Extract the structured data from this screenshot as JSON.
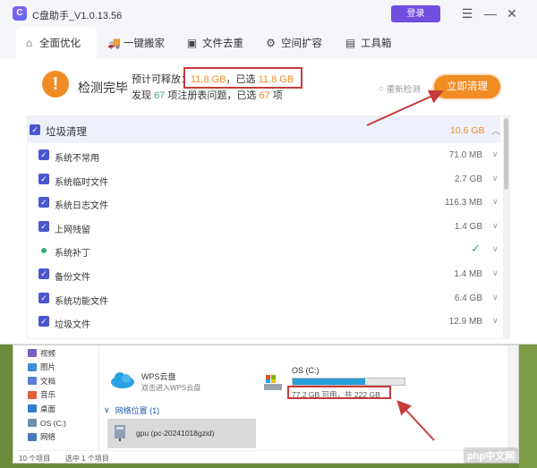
{
  "app": {
    "logo_text": "C",
    "title": "C盘助手_V1.0.13.56",
    "login_label": "登录",
    "controls": {
      "menu_icon": "menu-icon",
      "minimize_icon": "minimize-icon",
      "close_icon": "close-icon"
    }
  },
  "tabs": [
    {
      "label": "全面优化",
      "icon": "home-icon",
      "active": true
    },
    {
      "label": "一键搬家",
      "icon": "truck-icon",
      "active": false
    },
    {
      "label": "文件去重",
      "icon": "files-icon",
      "active": false
    },
    {
      "label": "空间扩容",
      "icon": "expand-icon",
      "active": false
    },
    {
      "label": "工具箱",
      "icon": "toolbox-icon",
      "active": false
    }
  ],
  "status": {
    "title": "检测完毕",
    "line1_prefix": "预计可释放：",
    "line1_value": "11.8 GB",
    "line1_mid": "，已选",
    "line1_selected": "11.8 GB",
    "line2_prefix": "发现",
    "line2_count": "67",
    "line2_mid": "项注册表问题，已选",
    "line2_selected": "67",
    "line2_suffix": "项",
    "recheck_label": "重新检测",
    "clean_label": "立即清理"
  },
  "list": {
    "header": {
      "label": "垃圾清理",
      "size": "10.6 GB"
    },
    "rows": [
      {
        "label": "系统不常用",
        "size": "71.0 MB",
        "state": "checked"
      },
      {
        "label": "系统临时文件",
        "size": "2.7 GB",
        "state": "checked"
      },
      {
        "label": "系统日志文件",
        "size": "116.3 MB",
        "state": "checked"
      },
      {
        "label": "上网残留",
        "size": "1.4 GB",
        "state": "checked"
      },
      {
        "label": "系统补丁",
        "size": "",
        "state": "done"
      },
      {
        "label": "备份文件",
        "size": "1.4 MB",
        "state": "checked"
      },
      {
        "label": "系统功能文件",
        "size": "6.4 GB",
        "state": "checked"
      },
      {
        "label": "垃圾文件",
        "size": "12.9 MB",
        "state": "checked"
      }
    ]
  },
  "explorer": {
    "nav": [
      {
        "label": "视频",
        "color": "#7a5fbf"
      },
      {
        "label": "图片",
        "color": "#3a8fd6"
      },
      {
        "label": "文档",
        "color": "#5b7ed6"
      },
      {
        "label": "音乐",
        "color": "#e0613d"
      },
      {
        "label": "桌面",
        "color": "#2f7fd1"
      },
      {
        "label": "OS (C:)",
        "color": "#6f8fb0"
      },
      {
        "label": "网络",
        "color": "#4a79b5"
      }
    ],
    "wps": {
      "name": "WPS云盘",
      "desc": "双击进入WPS云盘"
    },
    "drive": {
      "name": "OS (C:)",
      "free_text": "77.2 GB 可用，共 222 GB",
      "used_fraction": 0.652
    },
    "network": {
      "header": "网络位置 (1)",
      "item": "gpu (pc-20241018gzid)"
    },
    "status_items": "10 个项目",
    "status_selected": "选中 1 个项目"
  },
  "watermark": "php中文网",
  "colors": {
    "accent": "#f08c24",
    "primary": "#6f4ee0",
    "checkbox": "#4b57d0",
    "highlight": "#c73b3b",
    "progress": "#26a0da"
  }
}
